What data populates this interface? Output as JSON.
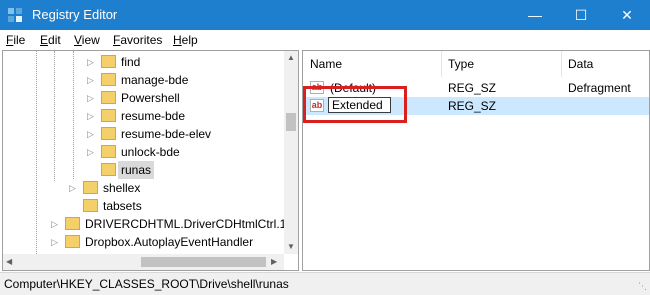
{
  "window": {
    "title": "Registry Editor",
    "controls": {
      "minimize": "—",
      "maximize": "☐",
      "close": "✕"
    },
    "accent_color": "#1f7fcf"
  },
  "menu": [
    {
      "label": "File",
      "key": "F",
      "rest": "ile"
    },
    {
      "label": "Edit",
      "key": "E",
      "rest": "dit"
    },
    {
      "label": "View",
      "key": "V",
      "rest": "iew"
    },
    {
      "label": "Favorites",
      "key": "F",
      "rest": "avorites"
    },
    {
      "label": "Help",
      "key": "H",
      "rest": "elp"
    }
  ],
  "tree": {
    "items": [
      {
        "label": "find",
        "expandable": true
      },
      {
        "label": "manage-bde",
        "expandable": true
      },
      {
        "label": "Powershell",
        "expandable": true
      },
      {
        "label": "resume-bde",
        "expandable": true
      },
      {
        "label": "resume-bde-elev",
        "expandable": true
      },
      {
        "label": "unlock-bde",
        "expandable": true
      },
      {
        "label": "runas",
        "expandable": false,
        "selected": true
      },
      {
        "label": "shellex",
        "expandable": true
      },
      {
        "label": "tabsets",
        "expandable": false
      },
      {
        "label": "DRIVERCDHTML.DriverCDHtmlCtrl.1",
        "expandable": true
      },
      {
        "label": "Dropbox.AutoplayEventHandler",
        "expandable": true
      }
    ]
  },
  "list": {
    "columns": [
      "Name",
      "Type",
      "Data"
    ],
    "rows": [
      {
        "name": "(Default)",
        "type": "REG_SZ",
        "data": "Defragment",
        "icon": "string-value-icon"
      },
      {
        "name": "Extended",
        "type": "REG_SZ",
        "data": "",
        "icon": "string-value-icon",
        "editing": true
      }
    ]
  },
  "status": {
    "path": "Computer\\HKEY_CLASSES_ROOT\\Drive\\shell\\runas"
  }
}
